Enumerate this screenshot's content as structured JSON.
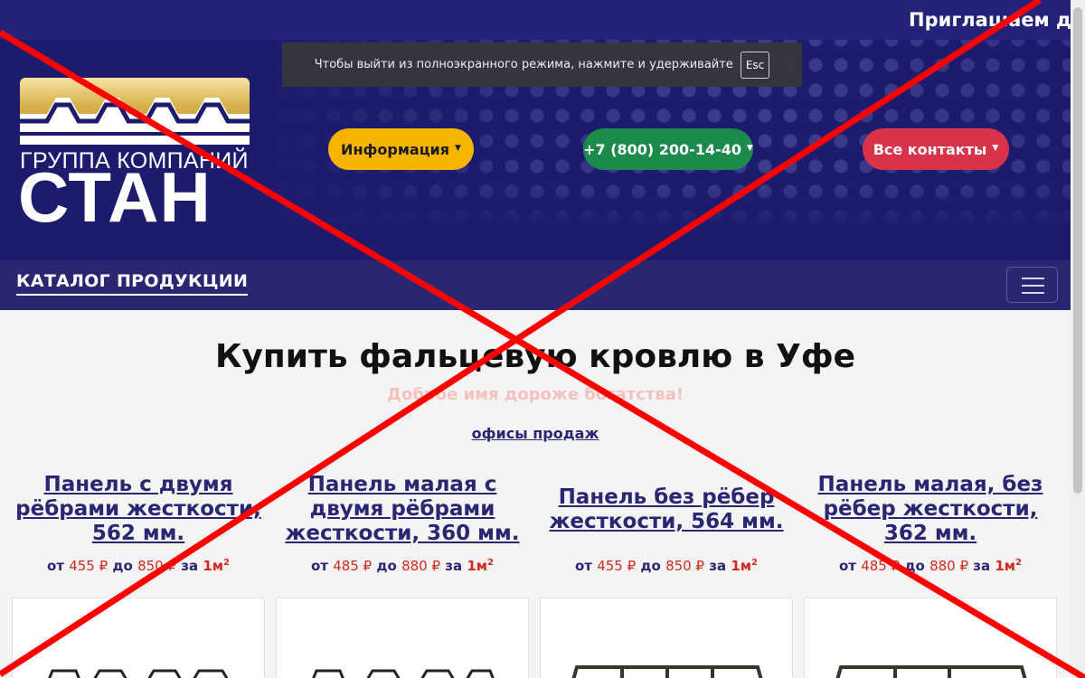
{
  "header": {
    "marquee_text": "Приглашаем ди",
    "fullscreen_toast": {
      "text": "Чтобы выйти из полноэкранного режима, нажмите и удерживайте",
      "key": "Esc"
    },
    "logo": {
      "subtitle": "ГРУППА КОМПАНИЙ",
      "name": "СТАН"
    },
    "buttons": {
      "info": "Информация",
      "phone": "+7 (800) 200-14-40",
      "contacts": "Все контакты"
    },
    "colors": {
      "info": "#f4b400",
      "phone": "#1b8a4a",
      "contacts": "#d8334a",
      "brand": "#1d1b6e"
    }
  },
  "nav": {
    "catalog_label": "КАТАЛОГ ПРОДУКЦИИ",
    "menu_icon": "hamburger-icon"
  },
  "main": {
    "title": "Купить фальцевую кровлю в Уфе",
    "slogan": "Доброе имя дороже богатства!",
    "offices_link": "офисы продаж",
    "products": [
      {
        "title": "Панель с двумя рёбрами жесткости, 562 мм.",
        "price_from_label": "от",
        "price_from": "455 ₽",
        "price_to_label": "до",
        "price_to": "850 ₽",
        "per_label": "за",
        "unit": "1м",
        "unit_sup": "2"
      },
      {
        "title": "Панель малая с двумя рёбрами жесткости, 360 мм.",
        "price_from_label": "от",
        "price_from": "485 ₽",
        "price_to_label": "до",
        "price_to": "880 ₽",
        "per_label": "за",
        "unit": "1м",
        "unit_sup": "2"
      },
      {
        "title": "Панель без рёбер жесткости, 564 мм.",
        "price_from_label": "от",
        "price_from": "455 ₽",
        "price_to_label": "до",
        "price_to": "850 ₽",
        "per_label": "за",
        "unit": "1м",
        "unit_sup": "2"
      },
      {
        "title": "Панель малая, без рёбер жесткости, 362 мм.",
        "price_from_label": "от",
        "price_from": "485 ₽",
        "price_to_label": "до",
        "price_to": "880 ₽",
        "per_label": "за",
        "unit": "1м",
        "unit_sup": "2"
      }
    ]
  },
  "overlay": {
    "cross_color": "#ff0000"
  }
}
